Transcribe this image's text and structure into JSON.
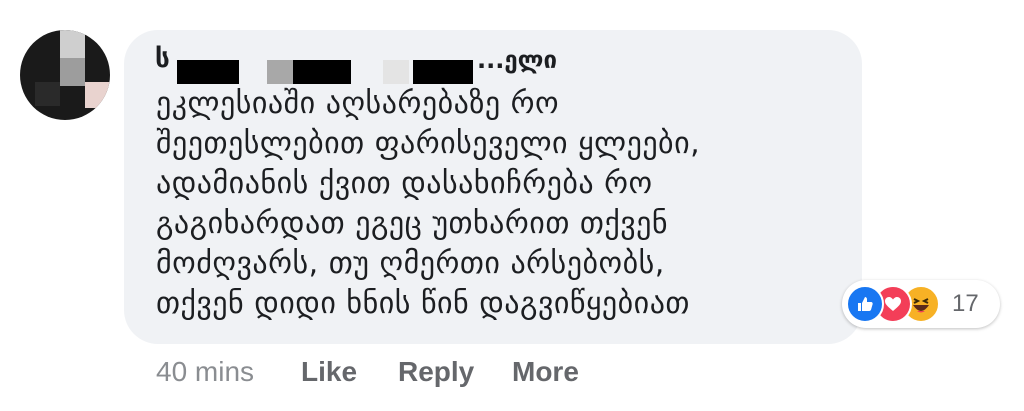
{
  "comment": {
    "author_initial": "ს",
    "author_tail": "...ელი",
    "lines": [
      "ეკლესიაში აღსარებაზე რო",
      "შეეთესლებით ფარისეველი ყლეები,",
      "ადამიანის ქვით დასახიჩრება რო",
      "გაგიხარდათ ეგეც უთხარით თქვენ",
      "მოძღვარს, თუ ღმერთი არსებობს,",
      "თქვენ დიდი ხნის წინ დაგვიწყებიათ"
    ]
  },
  "reactions": {
    "icons": [
      "like-icon",
      "love-icon",
      "haha-icon"
    ],
    "count": "17"
  },
  "actions": {
    "time": "40 mins",
    "like": "Like",
    "reply": "Reply",
    "more": "More"
  },
  "colors": {
    "bubble": "#f0f2f5",
    "like_blue": "#1877f2",
    "love_red": "#f33e58",
    "haha_yellow": "#f7b125",
    "secondary_text": "#65676b"
  }
}
